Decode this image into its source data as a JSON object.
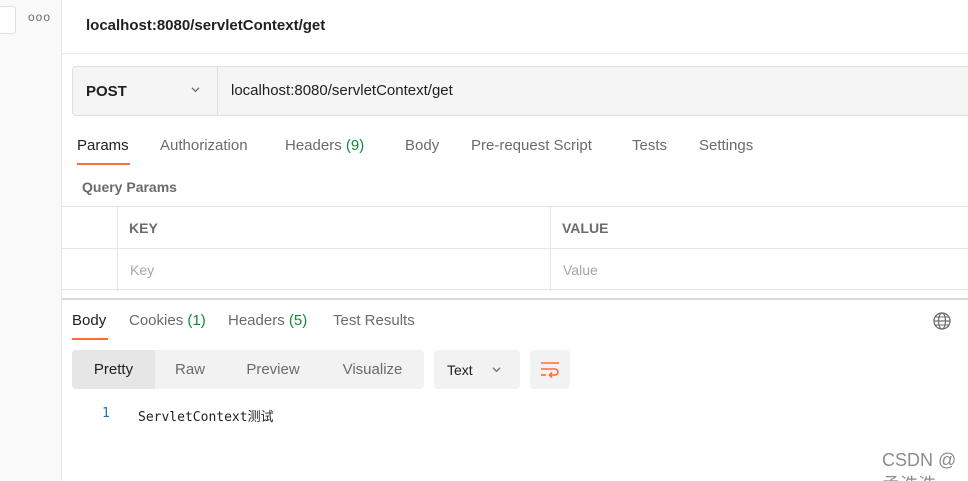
{
  "sidebar": {
    "more_icon": "more-horizontal-icon",
    "more_glyph": "ooo"
  },
  "request": {
    "title": "localhost:8080/servletContext/get",
    "method": "POST",
    "url": "localhost:8080/servletContext/get"
  },
  "request_tabs": [
    {
      "label": "Params",
      "active": true
    },
    {
      "label": "Authorization"
    },
    {
      "label": "Headers",
      "count": "(9)"
    },
    {
      "label": "Body"
    },
    {
      "label": "Pre-request Script"
    },
    {
      "label": "Tests"
    },
    {
      "label": "Settings"
    }
  ],
  "query_params": {
    "label": "Query Params",
    "columns": [
      "KEY",
      "VALUE"
    ],
    "key_placeholder": "Key",
    "value_placeholder": "Value"
  },
  "response_tabs": [
    {
      "label": "Body",
      "active": true
    },
    {
      "label": "Cookies",
      "count": "(1)"
    },
    {
      "label": "Headers",
      "count": "(5)"
    },
    {
      "label": "Test Results"
    }
  ],
  "view_modes": [
    "Pretty",
    "Raw",
    "Preview",
    "Visualize"
  ],
  "active_view": "Pretty",
  "format": "Text",
  "response_body": [
    {
      "line": "1",
      "text": "ServletContext测试"
    }
  ],
  "watermark": "CSDN @孟浩浩",
  "colors": {
    "accent": "#ff6c37",
    "count_green": "#0e8a3c",
    "line_number": "#1f6fb2"
  }
}
